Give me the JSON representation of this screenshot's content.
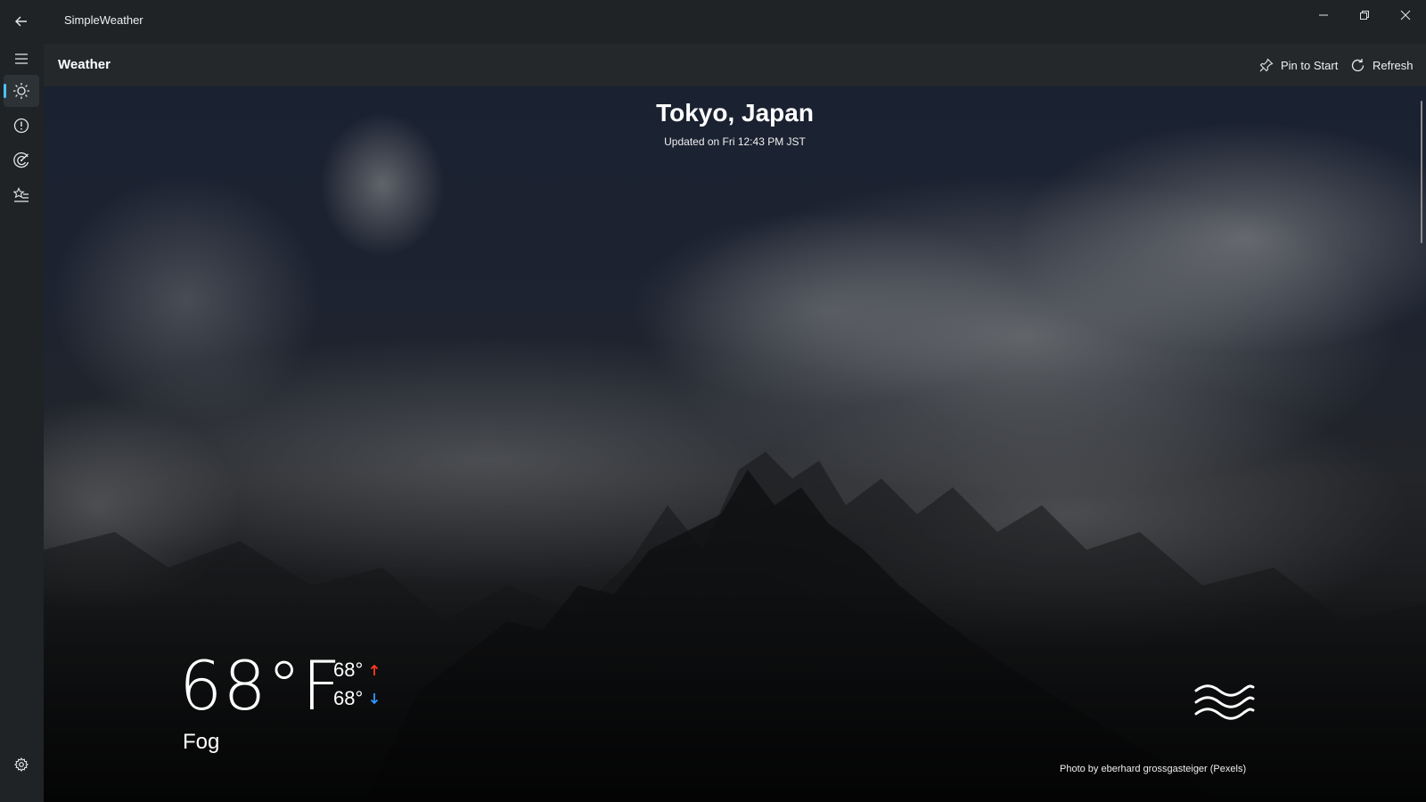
{
  "window": {
    "app_title": "SimpleWeather"
  },
  "nav": {
    "items": [
      {
        "name": "menu"
      },
      {
        "name": "weather",
        "selected": true
      },
      {
        "name": "alerts"
      },
      {
        "name": "radar"
      },
      {
        "name": "favorites"
      },
      {
        "name": "settings"
      }
    ],
    "accent_color": "#4cc2ff"
  },
  "header": {
    "title": "Weather",
    "pin_label": "Pin to Start",
    "refresh_label": "Refresh"
  },
  "location": {
    "city": "Tokyo, Japan",
    "updated": "Updated on Fri 12:43 PM JST"
  },
  "current": {
    "temperature": "68°F",
    "high": "68°",
    "low": "68°",
    "condition": "Fog",
    "high_arrow_color": "#ff3b1f",
    "low_arrow_color": "#2e9bff",
    "icon": "fog-icon"
  },
  "background": {
    "credit": "Photo by eberhard grossgasteiger (Pexels)"
  }
}
